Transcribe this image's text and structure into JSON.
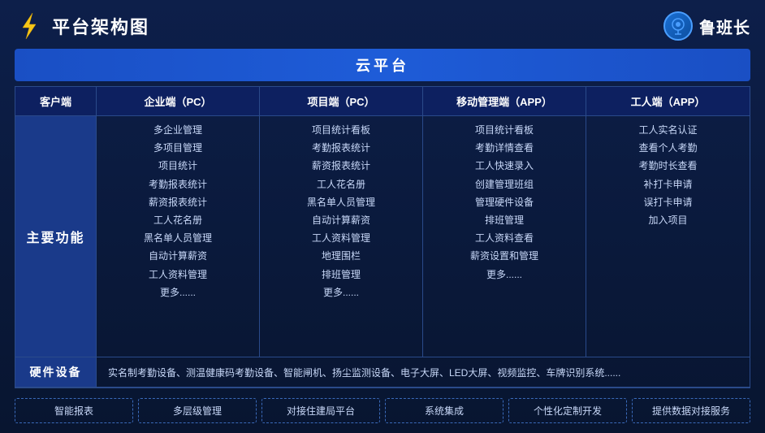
{
  "header": {
    "title": "平台架构图",
    "brand_name": "鲁班长"
  },
  "cloud_banner": "云平台",
  "column_headers": [
    "客户端",
    "企业端（PC）",
    "项目端（PC）",
    "移动管理端（APP）",
    "工人端（APP）"
  ],
  "main_row_label": "主要功能",
  "features": {
    "enterprise_pc": [
      "多企业管理",
      "多项目管理",
      "项目统计",
      "考勤报表统计",
      "薪资报表统计",
      "工人花名册",
      "黑名单人员管理",
      "自动计算薪资",
      "工人资料管理",
      "更多......"
    ],
    "project_pc": [
      "项目统计看板",
      "考勤报表统计",
      "薪资报表统计",
      "工人花名册",
      "黑名单人员管理",
      "自动计算薪资",
      "工人资料管理",
      "地理围栏",
      "排班管理",
      "更多......"
    ],
    "mobile_app": [
      "项目统计看板",
      "考勤详情查看",
      "工人快速录入",
      "创建管理班组",
      "管理硬件设备",
      "排班管理",
      "工人资料查看",
      "薪资设置和管理",
      "更多......"
    ],
    "worker_app": [
      "工人实名认证",
      "查看个人考勤",
      "考勤时长查看",
      "补打卡申请",
      "误打卡申请",
      "加入项目"
    ]
  },
  "hardware": {
    "label": "硬件设备",
    "content": "实名制考勤设备、测温健康码考勤设备、智能闸机、扬尘监测设备、电子大屏、LED大屏、视频监控、车牌识别系统......"
  },
  "bottom_items": [
    "智能报表",
    "多层级管理",
    "对接住建局平台",
    "系统集成",
    "个性化定制开发",
    "提供数据对接服务"
  ]
}
